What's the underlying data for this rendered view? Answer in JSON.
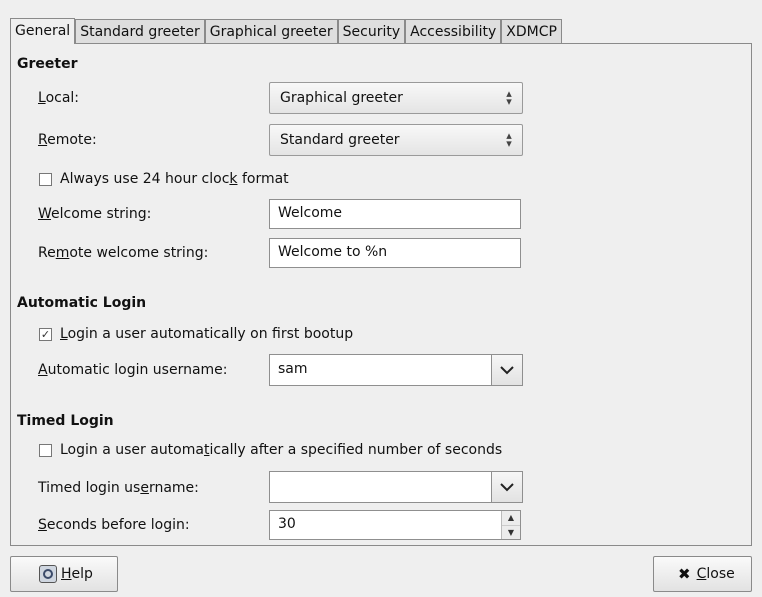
{
  "tabs": [
    {
      "label": "General"
    },
    {
      "label": "Standard greeter"
    },
    {
      "label": "Graphical greeter"
    },
    {
      "label": "Security"
    },
    {
      "label": "Accessibility"
    },
    {
      "label": "XDMCP"
    }
  ],
  "greeter": {
    "title": "Greeter",
    "local_label": {
      "pre": "",
      "key": "L",
      "post": "ocal:"
    },
    "local_value": "Graphical greeter",
    "remote_label": {
      "pre": "",
      "key": "R",
      "post": "emote:"
    },
    "remote_value": "Standard greeter",
    "clock_checkbox": {
      "pre": "Always use 24 hour cloc",
      "key": "k",
      "post": " format",
      "checked": false
    },
    "welcome_label": {
      "pre": "",
      "key": "W",
      "post": "elcome string:"
    },
    "welcome_value": "Welcome",
    "remote_welcome_label": {
      "pre": "Re",
      "key": "m",
      "post": "ote welcome string:"
    },
    "remote_welcome_value": "Welcome to %n"
  },
  "automatic_login": {
    "title": "Automatic Login",
    "checkbox": {
      "pre": "",
      "key": "L",
      "post": "ogin a user automatically on first bootup",
      "checked": true
    },
    "username_label": {
      "pre": "",
      "key": "A",
      "post": "utomatic login username:"
    },
    "username_value": "sam"
  },
  "timed_login": {
    "title": "Timed Login",
    "checkbox": {
      "pre": "Login a user automa",
      "key": "t",
      "post": "ically after a specified number of seconds",
      "checked": false
    },
    "username_label": {
      "pre": "Timed login us",
      "key": "e",
      "post": "rname:"
    },
    "username_value": "",
    "seconds_label": {
      "pre": "",
      "key": "S",
      "post": "econds before login:"
    },
    "seconds_value": "30"
  },
  "buttons": {
    "help": {
      "pre": "",
      "key": "H",
      "post": "elp"
    },
    "close": {
      "pre": "",
      "key": "C",
      "post": "lose"
    }
  }
}
